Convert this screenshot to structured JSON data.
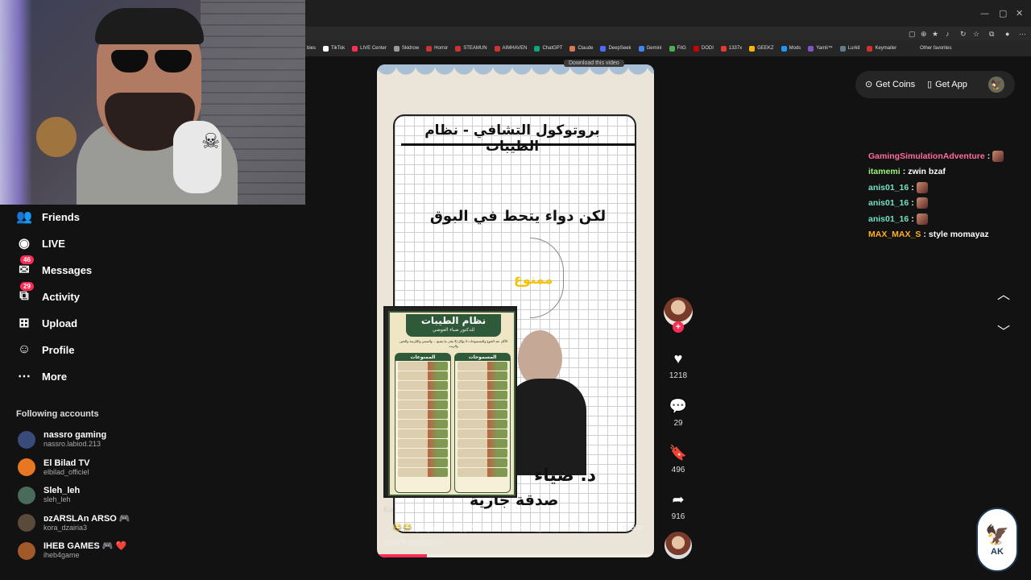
{
  "browser": {
    "bookmarks": [
      "TikTok",
      "LIVE Center",
      "Skidrow",
      "Horror",
      "STEAMUN",
      "AIMHAVEN",
      "ChatGPT",
      "Claude",
      "DeepSeek",
      "Gemini",
      "FitG",
      "DODI",
      "1337x",
      "GEEKZ",
      "Mods",
      "Yamli™",
      "Lurkit",
      "Keymailer"
    ],
    "bookmark_colors": [
      "#ffffff",
      "#ff2d55",
      "#999999",
      "#cc3333",
      "#cc3333",
      "#cc3333",
      "#10a37f",
      "#d97757",
      "#4d6bfe",
      "#4285f4",
      "#4caf50",
      "#cc0000",
      "#e53935",
      "#ffb300",
      "#2196f3",
      "#7e57c2",
      "#607d8b",
      "#d32f2f"
    ],
    "other_favorites": "Other favorites",
    "tab_fragment": "bies",
    "window_controls": [
      "—",
      "▢",
      "✕"
    ]
  },
  "sidebar": {
    "items": [
      {
        "label": "Friends",
        "icon": "friends-icon",
        "glyph": "👥",
        "badge": ""
      },
      {
        "label": "LIVE",
        "icon": "live-icon",
        "glyph": "◉",
        "badge": ""
      },
      {
        "label": "Messages",
        "icon": "messages-icon",
        "glyph": "✉",
        "badge": "46"
      },
      {
        "label": "Activity",
        "icon": "activity-icon",
        "glyph": "⧉",
        "badge": "29"
      },
      {
        "label": "Upload",
        "icon": "upload-icon",
        "glyph": "⊞",
        "badge": ""
      },
      {
        "label": "Profile",
        "icon": "profile-icon",
        "glyph": "☺",
        "badge": ""
      },
      {
        "label": "More",
        "icon": "more-icon",
        "glyph": "⋯",
        "badge": ""
      }
    ],
    "following_title": "Following accounts",
    "accounts": [
      {
        "name": "nassro gaming",
        "handle": "nassro.labiod.213",
        "color": "#3a4a7a"
      },
      {
        "name": "El Bilad TV",
        "handle": "elbilad_officiel",
        "color": "#e87722"
      },
      {
        "name": "Sleh_leh",
        "handle": "sleh_leh",
        "color": "#4a6b5a"
      },
      {
        "name": "ᴅᴢARSLAn ARSO 🎮",
        "handle": "kora_dzairia3",
        "color": "#5a4a3a"
      },
      {
        "name": "IHEB GAMES 🎮 ❤️",
        "handle": "iheb4game",
        "color": "#a05a2a"
      }
    ]
  },
  "video": {
    "title_ar": "بروتوكول التشافي - نظام الطيبات",
    "line2_ar": "لكن دواء يتحط في البوق",
    "forbidden_ar": "ممنوع",
    "name_ar": "د. ضياء",
    "sadaqa_ar": "صدقة جارية",
    "poster": {
      "title_ar": "نظام الطيبات",
      "subtitle_ar": "للدكتور ضياء العوضي",
      "desc_ar": "الأكل عند الجوع والمسموحات لا يؤكل إلا بقدر ما يشبع ... والسمن والكريمة والجبن والزيت",
      "allowed_ar": "المسموحات",
      "forbidden_ar": "الممنوعات"
    },
    "author_fragment": "Ka",
    "caption": "... 😂😂 شعب_الطيبات_مالو_حل / #الطيبات للدكتور ضياء العوضي",
    "more": "more",
    "see_translation": "See translation",
    "download_tip": "Download this video",
    "progress": 0.18
  },
  "actions": {
    "likes": "1218",
    "comments": "29",
    "saves": "496",
    "shares": "916"
  },
  "topbar": {
    "get_coins": "Get Coins",
    "get_app": "Get App"
  },
  "chat": [
    {
      "user": "GamingSimulationAdventure",
      "text": "",
      "color": "#ff6b9d",
      "emote": true
    },
    {
      "user": "itamemi",
      "text": "zwin bzaf",
      "color": "#9ef07a",
      "emote": false
    },
    {
      "user": "anis01_16",
      "text": "",
      "color": "#6fe3c4",
      "emote": true
    },
    {
      "user": "anis01_16",
      "text": "",
      "color": "#6fe3c4",
      "emote": true
    },
    {
      "user": "anis01_16",
      "text": "",
      "color": "#6fe3c4",
      "emote": true
    },
    {
      "user": "MAX_MAX_S",
      "text": "style momayaz",
      "color": "#ffb020",
      "emote": false
    }
  ],
  "logo": {
    "text": "AK"
  }
}
